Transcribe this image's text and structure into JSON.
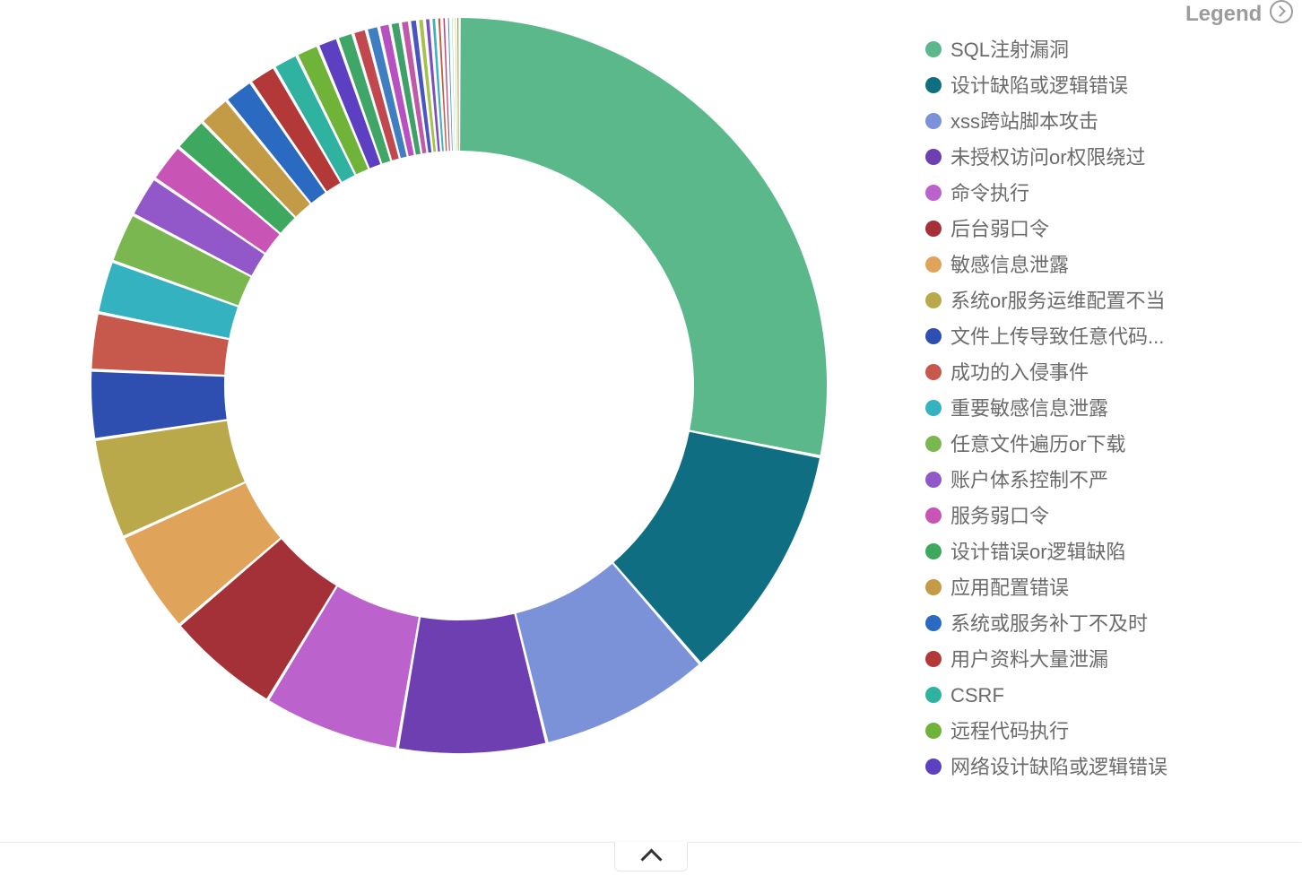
{
  "legend_title": "Legend",
  "chart_data": {
    "type": "pie",
    "title": "",
    "donut": true,
    "series": [
      {
        "name": "SQL注射漏洞",
        "value": 28.0,
        "color": "#5ab88a"
      },
      {
        "name": "设计缺陷或逻辑错误",
        "value": 10.5,
        "color": "#106e82"
      },
      {
        "name": "xss跨站脚本攻击",
        "value": 7.5,
        "color": "#7b92d9"
      },
      {
        "name": "未授权访问or权限绕过",
        "value": 6.5,
        "color": "#6e3fb0"
      },
      {
        "name": "命令执行",
        "value": 6.0,
        "color": "#bb62cd"
      },
      {
        "name": "后台弱口令",
        "value": 5.0,
        "color": "#a53138"
      },
      {
        "name": "敏感信息泄露",
        "value": 4.5,
        "color": "#e0a35a"
      },
      {
        "name": "系统or服务运维配置不当",
        "value": 4.4,
        "color": "#b9a94a"
      },
      {
        "name": "文件上传导致任意代码...",
        "value": 3.0,
        "color": "#2f4fb0"
      },
      {
        "name": "成功的入侵事件",
        "value": 2.5,
        "color": "#c6594c"
      },
      {
        "name": "重要敏感信息泄露",
        "value": 2.3,
        "color": "#35b2c0"
      },
      {
        "name": "任意文件遍历or下载",
        "value": 2.2,
        "color": "#7ab750"
      },
      {
        "name": "账户体系控制不严",
        "value": 1.8,
        "color": "#9258c9"
      },
      {
        "name": "服务弱口令",
        "value": 1.7,
        "color": "#c854b5"
      },
      {
        "name": "设计错误or逻辑缺陷",
        "value": 1.5,
        "color": "#3fa85f"
      },
      {
        "name": "应用配置错误",
        "value": 1.4,
        "color": "#c39a45"
      },
      {
        "name": "系统或服务补丁不及时",
        "value": 1.3,
        "color": "#2a6bc1"
      },
      {
        "name": "用户资料大量泄漏",
        "value": 1.2,
        "color": "#b33939"
      },
      {
        "name": "CSRF",
        "value": 1.1,
        "color": "#2fb3a0"
      },
      {
        "name": "远程代码执行",
        "value": 1.0,
        "color": "#6fb338"
      },
      {
        "name": "网络设计缺陷或逻辑错误",
        "value": 0.9,
        "color": "#5d3fc1"
      },
      {
        "name": "",
        "value": 0.7,
        "color": "#3fa667"
      },
      {
        "name": "",
        "value": 0.6,
        "color": "#c1484f"
      },
      {
        "name": "",
        "value": 0.55,
        "color": "#3f7ec1"
      },
      {
        "name": "",
        "value": 0.5,
        "color": "#b750c1"
      },
      {
        "name": "",
        "value": 0.45,
        "color": "#3fa06a"
      },
      {
        "name": "",
        "value": 0.4,
        "color": "#c159a8"
      },
      {
        "name": "",
        "value": 0.35,
        "color": "#4a55c4"
      },
      {
        "name": "",
        "value": 0.3,
        "color": "#a6c14d"
      },
      {
        "name": "",
        "value": 0.28,
        "color": "#7a4fc1"
      },
      {
        "name": "",
        "value": 0.25,
        "color": "#3fb1c1"
      },
      {
        "name": "",
        "value": 0.22,
        "color": "#c15f3f"
      },
      {
        "name": "",
        "value": 0.2,
        "color": "#c13f7a"
      },
      {
        "name": "",
        "value": 0.18,
        "color": "#3f9ec1"
      },
      {
        "name": "",
        "value": 0.15,
        "color": "#56c13f"
      },
      {
        "name": "",
        "value": 0.12,
        "color": "#c1b73f"
      },
      {
        "name": "",
        "value": 0.1,
        "color": "#8a8a3a"
      }
    ]
  },
  "legend_visible_count": 21
}
